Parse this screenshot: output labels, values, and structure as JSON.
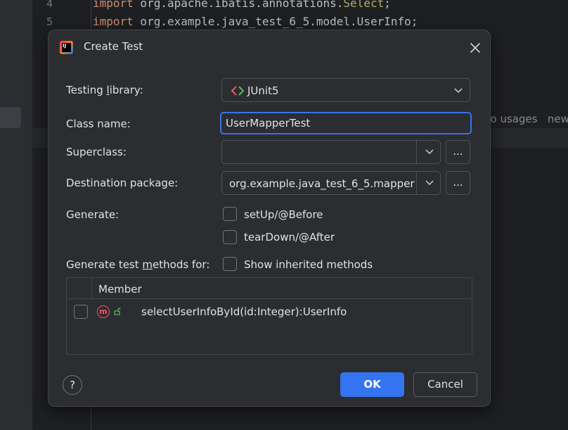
{
  "editor": {
    "line_numbers": [
      "4",
      "5"
    ],
    "line4": {
      "kw": "import",
      "rest": " org.apache.ibatis.annotations.",
      "annotation": "Select",
      "end": ";"
    },
    "line5": {
      "kw": "import",
      "rest": " org.example.java_test_6_5.model.UserInfo;"
    },
    "hint": "no usages   new"
  },
  "dialog": {
    "title": "Create Test",
    "icon": "intellij-idea-icon",
    "testing_library": {
      "label_pre": "Testing ",
      "label_u": "l",
      "label_post": "ibrary:",
      "value": "JUnit5"
    },
    "class_name": {
      "label": "Class name:",
      "value": "UserMapperTest"
    },
    "superclass": {
      "label": "Superclass:",
      "value": "",
      "browse": "..."
    },
    "destination": {
      "label": "Destination package:",
      "value": "org.example.java_test_6_5.mapper",
      "browse": "..."
    },
    "generate": {
      "label": "Generate:",
      "setup": "setUp/@Before",
      "teardown": "tearDown/@After"
    },
    "methods_for": {
      "label_pre": "Generate test ",
      "label_u": "m",
      "label_post": "ethods for:",
      "show_inherited": "Show inherited methods"
    },
    "table": {
      "column": "Member",
      "rows": [
        {
          "label": "selectUserInfoById(id:Integer):UserInfo",
          "checked": false
        }
      ]
    },
    "help": "?",
    "ok": "OK",
    "cancel": "Cancel"
  },
  "colors": {
    "accent": "#3574f0",
    "method_icon": "#f75464",
    "background": "#2b2d30"
  }
}
